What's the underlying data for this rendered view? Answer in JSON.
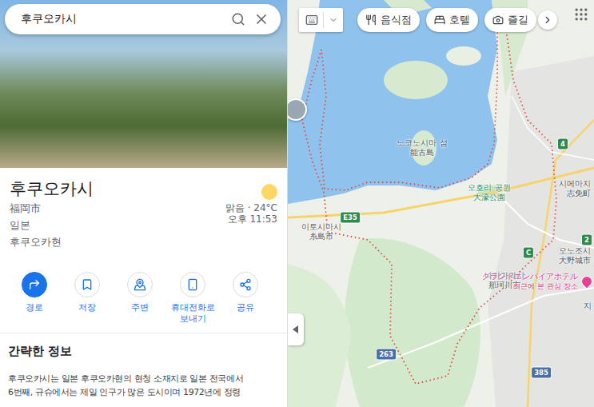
{
  "search": {
    "value": "후쿠오카시"
  },
  "place": {
    "title": "후쿠오카시",
    "details": [
      "福岡市",
      "일본",
      "후쿠오카현"
    ],
    "weather": {
      "condition": "맑음 · 24°C",
      "time": "오후 11:53"
    }
  },
  "actions": [
    {
      "label": "경로",
      "primary": true
    },
    {
      "label": "저장",
      "primary": false
    },
    {
      "label": "주변",
      "primary": false
    },
    {
      "label": "휴대전화로 보내기",
      "primary": false
    },
    {
      "label": "공유",
      "primary": false
    }
  ],
  "overview": {
    "heading": "간략한 정보",
    "lines": [
      "후쿠오카시는 일본 후쿠오카현의 현청 소재지로 일본 전국에서",
      "6번째, 규슈에서는 제일 인구가 많은 도시이며 1972년에 정령"
    ]
  },
  "map": {
    "chips": [
      {
        "label": "음식점"
      },
      {
        "label": "호텔"
      },
      {
        "label": "즐길"
      }
    ],
    "labels": [
      {
        "text": "노코노시마 섬",
        "sub": "能古島",
        "kind": "place"
      },
      {
        "text": "오호리 공원",
        "sub": "大濠公園",
        "kind": "park"
      },
      {
        "text": "시메마치",
        "sub": "志免町",
        "kind": "place"
      },
      {
        "text": "이토시마시",
        "sub": "糸島市",
        "kind": "place"
      },
      {
        "text": "오노조시",
        "sub": "大野城市",
        "kind": "place"
      },
      {
        "text": "나카가와시",
        "sub": "那珂川市",
        "kind": "place"
      },
      {
        "text": "グランドエンパイアホテル",
        "sub": "최근에 본 관심 장소",
        "kind": "hotel"
      },
      {
        "text": "지",
        "sub": "",
        "kind": "place"
      }
    ],
    "road_shields": [
      {
        "text": "E35",
        "color": "#2f8a4d"
      },
      {
        "text": "4",
        "color": "#2f8a4d"
      },
      {
        "text": "C",
        "color": "#2f8a4d"
      },
      {
        "text": "263",
        "color": "#4a6fa5"
      },
      {
        "text": "385",
        "color": "#4a6fa5"
      },
      {
        "text": "2",
        "color": "#2f8a4d"
      }
    ]
  }
}
